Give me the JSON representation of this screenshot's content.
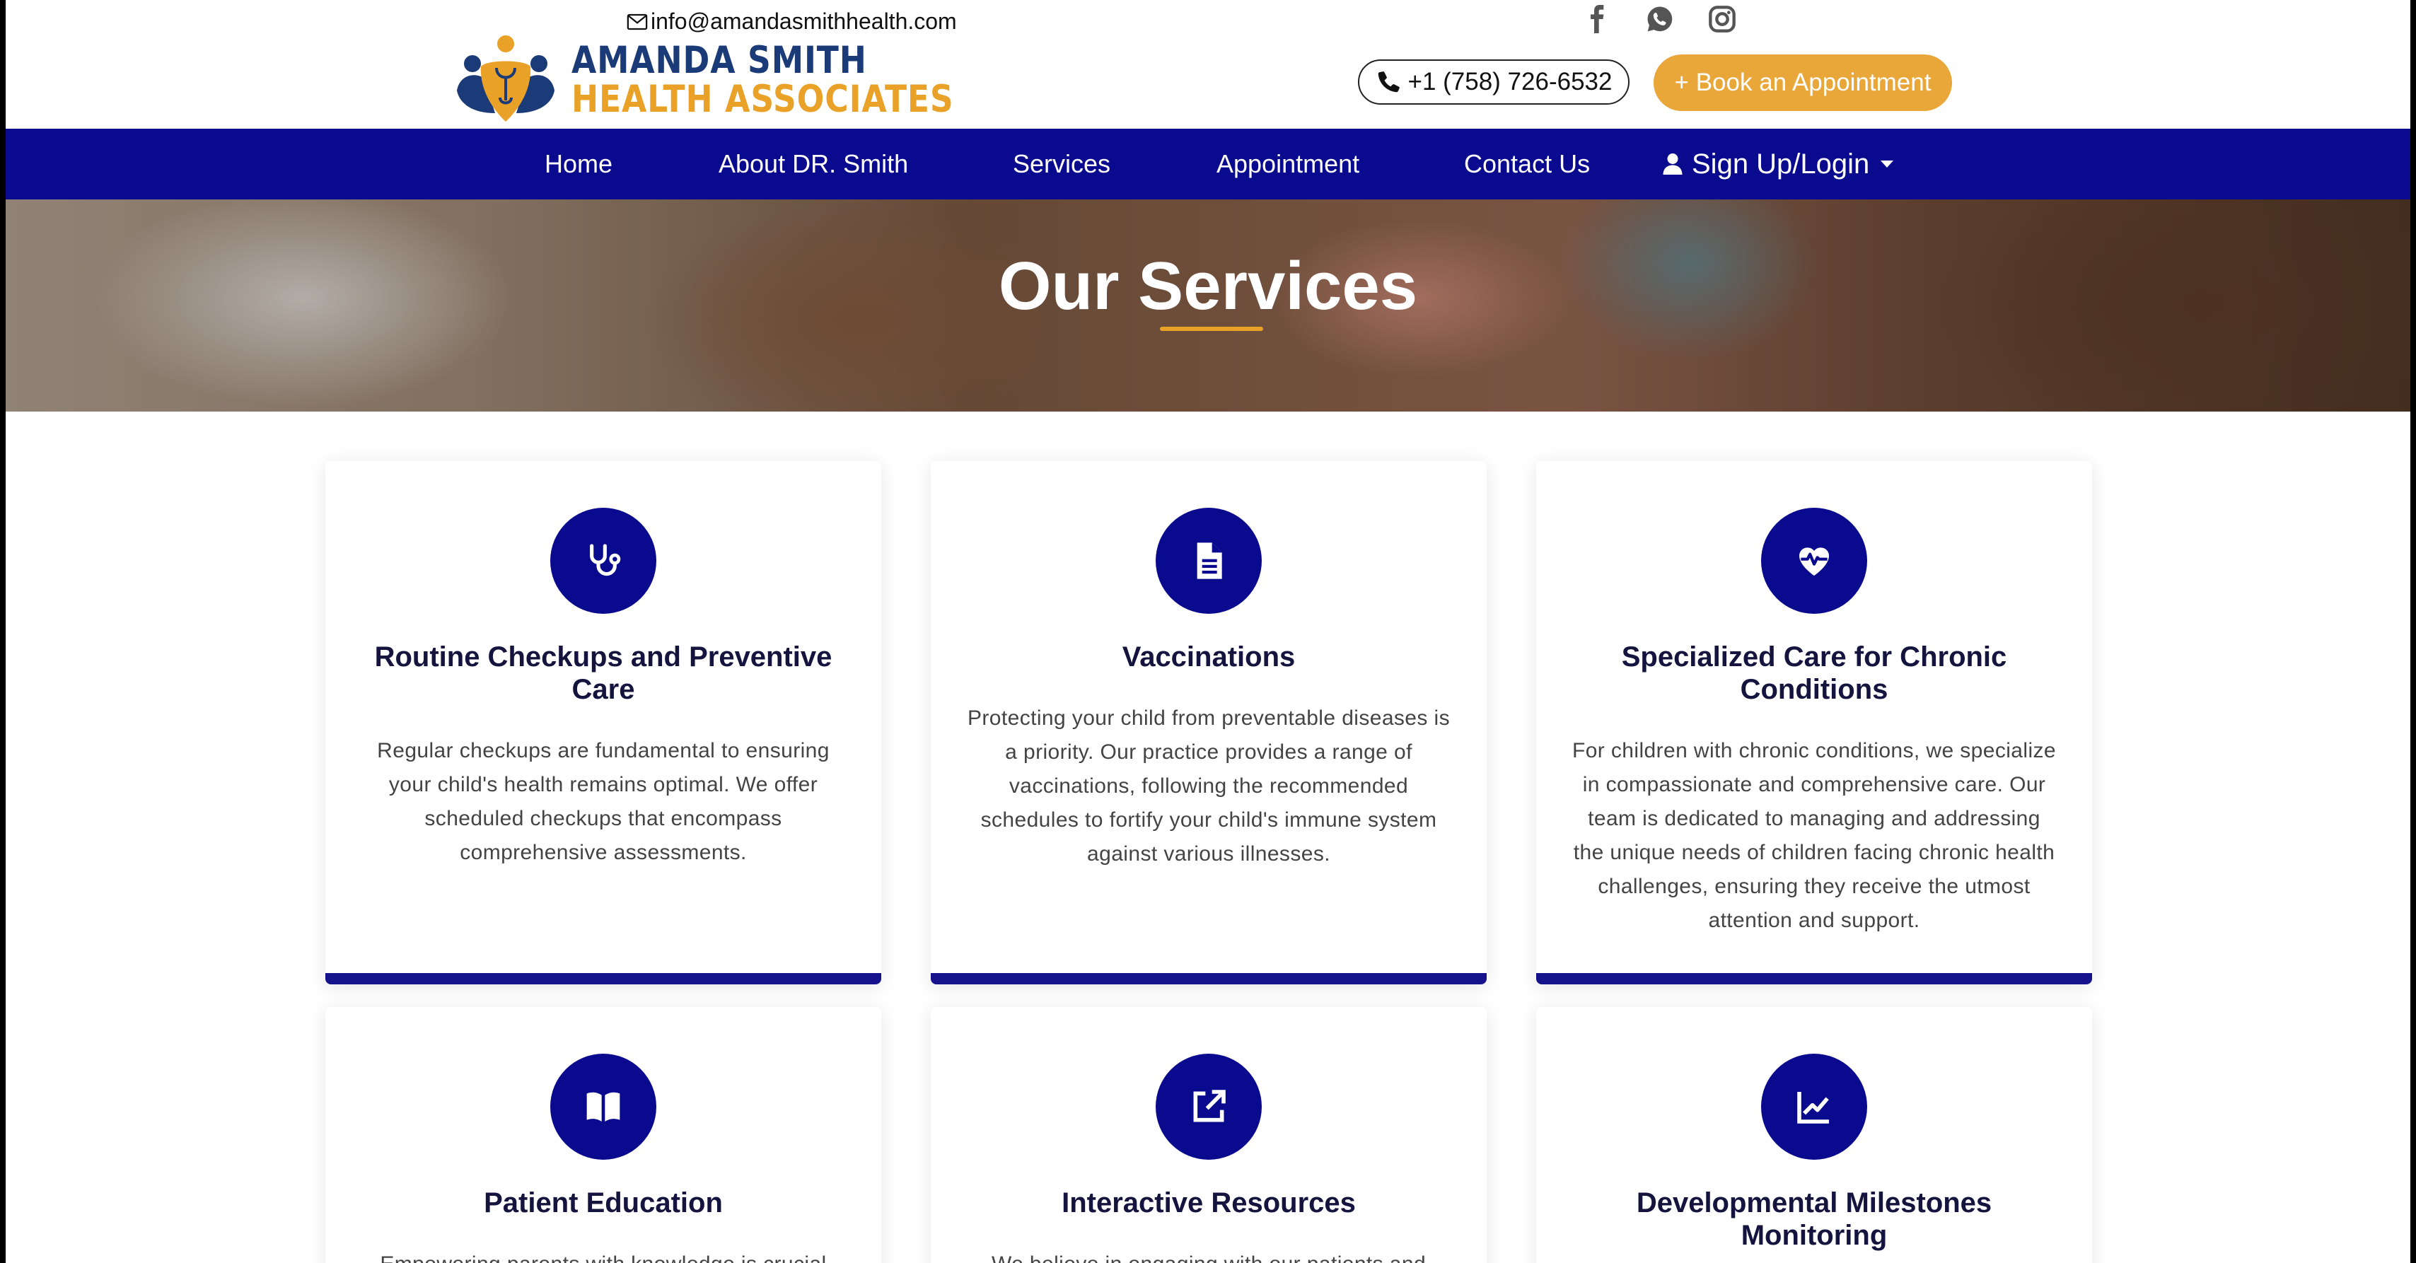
{
  "header": {
    "email": "info@amandasmithhealth.com",
    "logo_line1": "AMANDA SMITH",
    "logo_line2": "HEALTH ASSOCIATES",
    "phone": "+1 (758) 726-6532",
    "book_label": "+ Book an Appointment",
    "socials": [
      "facebook-icon",
      "whatsapp-icon",
      "instagram-icon"
    ]
  },
  "nav": {
    "items": [
      "Home",
      "About DR. Smith",
      "Services",
      "Appointment",
      "Contact Us"
    ],
    "login_label": "Sign Up/Login"
  },
  "hero": {
    "title": "Our Services"
  },
  "services": [
    {
      "icon": "stethoscope-icon",
      "title": "Routine Checkups and Preventive Care",
      "text": "Regular checkups are fundamental to ensuring your child's health remains optimal. We offer scheduled checkups that encompass comprehensive assessments."
    },
    {
      "icon": "document-icon",
      "title": "Vaccinations",
      "text": "Protecting your child from preventable diseases is a priority. Our practice provides a range of vaccinations, following the recommended schedules to fortify your child's immune system against various illnesses."
    },
    {
      "icon": "heart-pulse-icon",
      "title": "Specialized Care for Chronic Conditions",
      "text": "For children with chronic conditions, we specialize in compassionate and comprehensive care. Our team is dedicated to managing and addressing the unique needs of children facing chronic health challenges, ensuring they receive the utmost attention and support."
    },
    {
      "icon": "book-icon",
      "title": "Patient Education",
      "text": "Empowering parents with knowledge is crucial"
    },
    {
      "icon": "external-link-icon",
      "title": "Interactive Resources",
      "text": "We believe in engaging with our patients and"
    },
    {
      "icon": "chart-line-icon",
      "title": "Developmental Milestones Monitoring",
      "text": ""
    }
  ],
  "colors": {
    "primary": "#0a0a8f",
    "accent": "#e9a73a",
    "card_bar": "#16128c",
    "title_text": "#14143f"
  }
}
